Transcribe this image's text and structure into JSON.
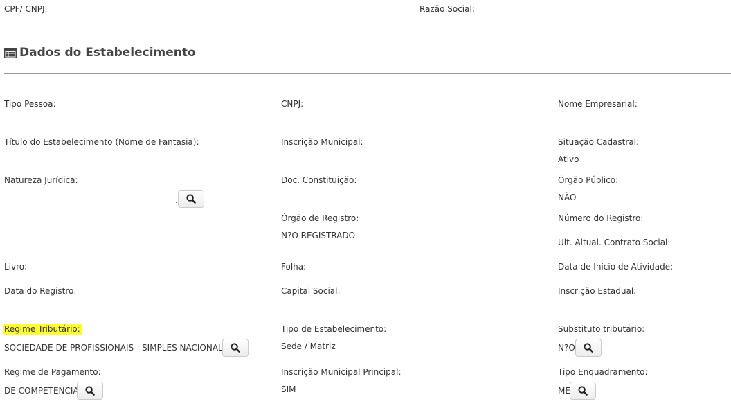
{
  "header": {
    "cpf_label": "CPF/ CNPJ:",
    "razao_label": "Razão Social:"
  },
  "section": {
    "title": "Dados do Estabelecimento",
    "icon": "list-alt-icon"
  },
  "fields": {
    "tipo_pessoa": {
      "label": "Tipo Pessoa:"
    },
    "cnpj": {
      "label": "CNPJ:"
    },
    "nome_empresarial": {
      "label": "Nome Empresarial:"
    },
    "titulo": {
      "label": "Título do Estabelecimento (Nome de Fantasia):"
    },
    "inscricao_municipal": {
      "label": "Inscrição Municipal:"
    },
    "situacao": {
      "label": "Situação Cadastral:",
      "value": "Ativo"
    },
    "natureza": {
      "label": "Natureza Jurídica:",
      "value": "."
    },
    "doc_constituicao": {
      "label": "Doc. Constituição:"
    },
    "orgao_publico": {
      "label": "Órgão Público:",
      "value": "NÃO"
    },
    "orgao_registro": {
      "label": "Órgão de Registro:",
      "value": "N?O REGISTRADO -"
    },
    "numero_registro": {
      "label": "Número do Registro:"
    },
    "ult_altual": {
      "label": "Ult. Altual. Contrato Social:"
    },
    "livro": {
      "label": "Livro:"
    },
    "folha": {
      "label": "Folha:"
    },
    "data_inicio": {
      "label": "Data de Início de Atividade:"
    },
    "data_registro": {
      "label": "Data do Registro:"
    },
    "capital_social": {
      "label": "Capital Social:"
    },
    "inscricao_estadual": {
      "label": "Inscrição Estadual:"
    },
    "regime_tributario": {
      "label": "Regime Tributário:",
      "value": "SOCIEDADE DE PROFISSIONAIS - SIMPLES NACIONAL"
    },
    "tipo_estabelecimento": {
      "label": "Tipo de Estabelecimento:",
      "value": "Sede / Matriz"
    },
    "substituto": {
      "label": "Substituto tributário:",
      "value": "N?O"
    },
    "regime_pagamento": {
      "label": "Regime de Pagamento:",
      "value": "DE COMPETENCIA"
    },
    "inscricao_principal": {
      "label": "Inscrição Municipal Principal:",
      "value": "SIM"
    },
    "tipo_enquadramento": {
      "label": "Tipo Enquadramento:",
      "value": "ME"
    }
  },
  "colors": {
    "highlight": "#ffff33",
    "text": "#333333",
    "divider": "#999999"
  }
}
